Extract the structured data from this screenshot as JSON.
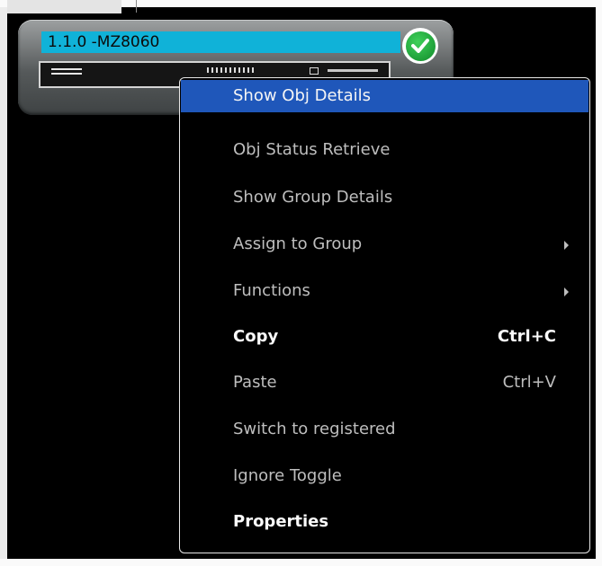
{
  "device": {
    "label": "1.1.0 -MZ8060",
    "status_icon": "checkmark-icon",
    "status_color": "#1fae3b",
    "label_color": "#10b2d8"
  },
  "context_menu": {
    "highlight_color": "#1f57ba",
    "items": [
      {
        "label": "Show Obj Details",
        "shortcut": "",
        "submenu": false,
        "state": "highlighted"
      },
      {
        "label": "Obj Status Retrieve",
        "shortcut": "",
        "submenu": false,
        "state": "normal"
      },
      {
        "label": "Show Group Details",
        "shortcut": "",
        "submenu": false,
        "state": "normal"
      },
      {
        "label": "Assign to Group",
        "shortcut": "",
        "submenu": true,
        "state": "normal"
      },
      {
        "label": "Functions",
        "shortcut": "",
        "submenu": true,
        "state": "normal"
      },
      {
        "label": "Copy",
        "shortcut": "Ctrl+C",
        "submenu": false,
        "state": "bold"
      },
      {
        "label": "Paste",
        "shortcut": "Ctrl+V",
        "submenu": false,
        "state": "normal"
      },
      {
        "label": "Switch to registered",
        "shortcut": "",
        "submenu": false,
        "state": "normal"
      },
      {
        "label": "Ignore Toggle",
        "shortcut": "",
        "submenu": false,
        "state": "normal"
      },
      {
        "label": "Properties",
        "shortcut": "",
        "submenu": false,
        "state": "bold"
      }
    ]
  }
}
